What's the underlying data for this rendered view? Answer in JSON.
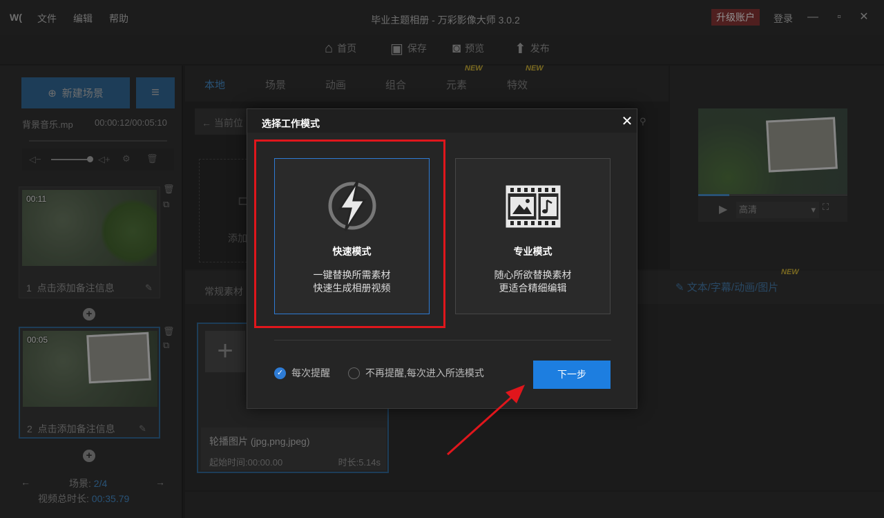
{
  "app": {
    "logo": "W(",
    "title": "毕业主题相册 - 万彩影像大师 3.0.2",
    "menu": [
      "文件",
      "编辑",
      "帮助"
    ],
    "upgrade": "升级账户",
    "login": "登录"
  },
  "toolbar": {
    "home": "首页",
    "save": "保存",
    "preview": "预览",
    "publish": "发布"
  },
  "left_panel": {
    "new_scene": "新建场景",
    "music_file": "背景音乐.mp",
    "music_time": "00:00:12/00:05:10",
    "scenes": [
      {
        "time": "00:11",
        "index": "1",
        "note": "点击添加备注信息"
      },
      {
        "time": "00:05",
        "index": "2",
        "note": "点击添加备注信息"
      }
    ],
    "scene_nav_label": "场景:",
    "scene_nav_value": "2/4",
    "total_label": "视频总时长:",
    "total_value": "00:35.79"
  },
  "tabs": [
    "本地",
    "场景",
    "动画",
    "组合",
    "元素",
    "特效"
  ],
  "new_badge": "NEW",
  "partial_texts": {
    "current": "当前位",
    "add": "添加",
    "regular": "常规素材"
  },
  "preview": {
    "quality": "高清"
  },
  "mid_tabs": {
    "text_tab": "文本/字幕/动画/图片"
  },
  "material": {
    "title": "轮播图片 (jpg,png,jpeg)",
    "start": "起始时间:00:00.00",
    "duration": "时长:5.14s"
  },
  "dialog": {
    "title": "选择工作模式",
    "fast": {
      "name": "快速模式",
      "desc1": "一键替换所需素材",
      "desc2": "快速生成相册视频"
    },
    "pro": {
      "name": "专业模式",
      "desc1": "随心所欲替换素材",
      "desc2": "更适合精细编辑"
    },
    "option_always": "每次提醒",
    "option_never": "不再提醒,每次进入所选模式",
    "next": "下一步"
  },
  "colors": {
    "accent": "#1d7ee0",
    "highlight": "#e0161c",
    "new_badge": "#bba233"
  }
}
